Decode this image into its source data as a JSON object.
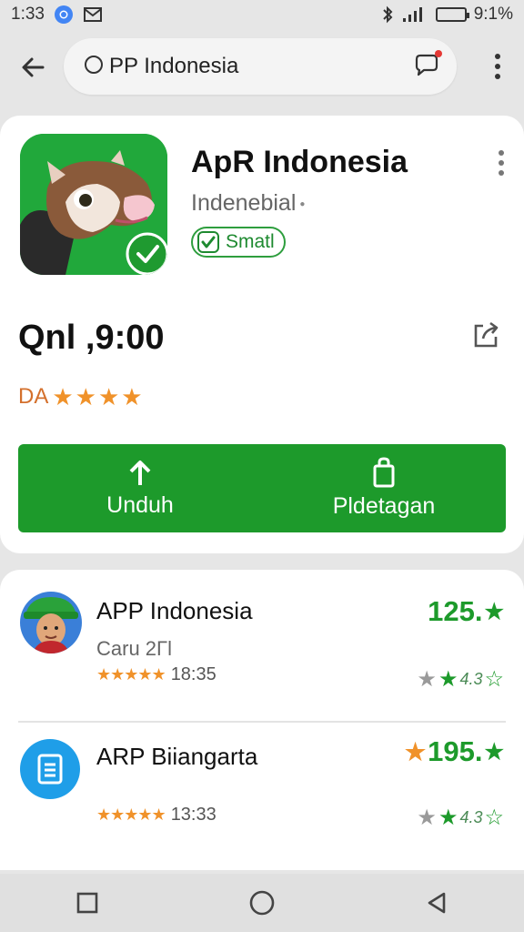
{
  "status_bar": {
    "time": "1:33",
    "battery_text": "9:1%",
    "icons": [
      "chrome-icon",
      "mail-icon",
      "bluetooth-icon",
      "signal-icon",
      "battery-icon"
    ]
  },
  "search": {
    "text": "PP Indonesia"
  },
  "app": {
    "title": "ApR Indonesia",
    "subtitle": "Indenebial",
    "verified_label": "Smatl",
    "price": "Qnl ,9:00",
    "rating_label": "DA",
    "rating_stars": 4,
    "download_label": "Unduh",
    "details_label": "Pldetagan"
  },
  "list": {
    "items": [
      {
        "title": "APP Indonesia",
        "sub": "Caru 2Γl",
        "meta_time": "18:35",
        "score": "125.",
        "rate_text": "4.3"
      },
      {
        "title": "ARP Biiangarta",
        "meta_time": "13:33",
        "score": "195.",
        "rate_text": "4.3"
      }
    ]
  },
  "colors": {
    "accent_green": "#1d9a2b",
    "star_orange": "#f0922a",
    "icon_blue": "#1f9ee8"
  }
}
